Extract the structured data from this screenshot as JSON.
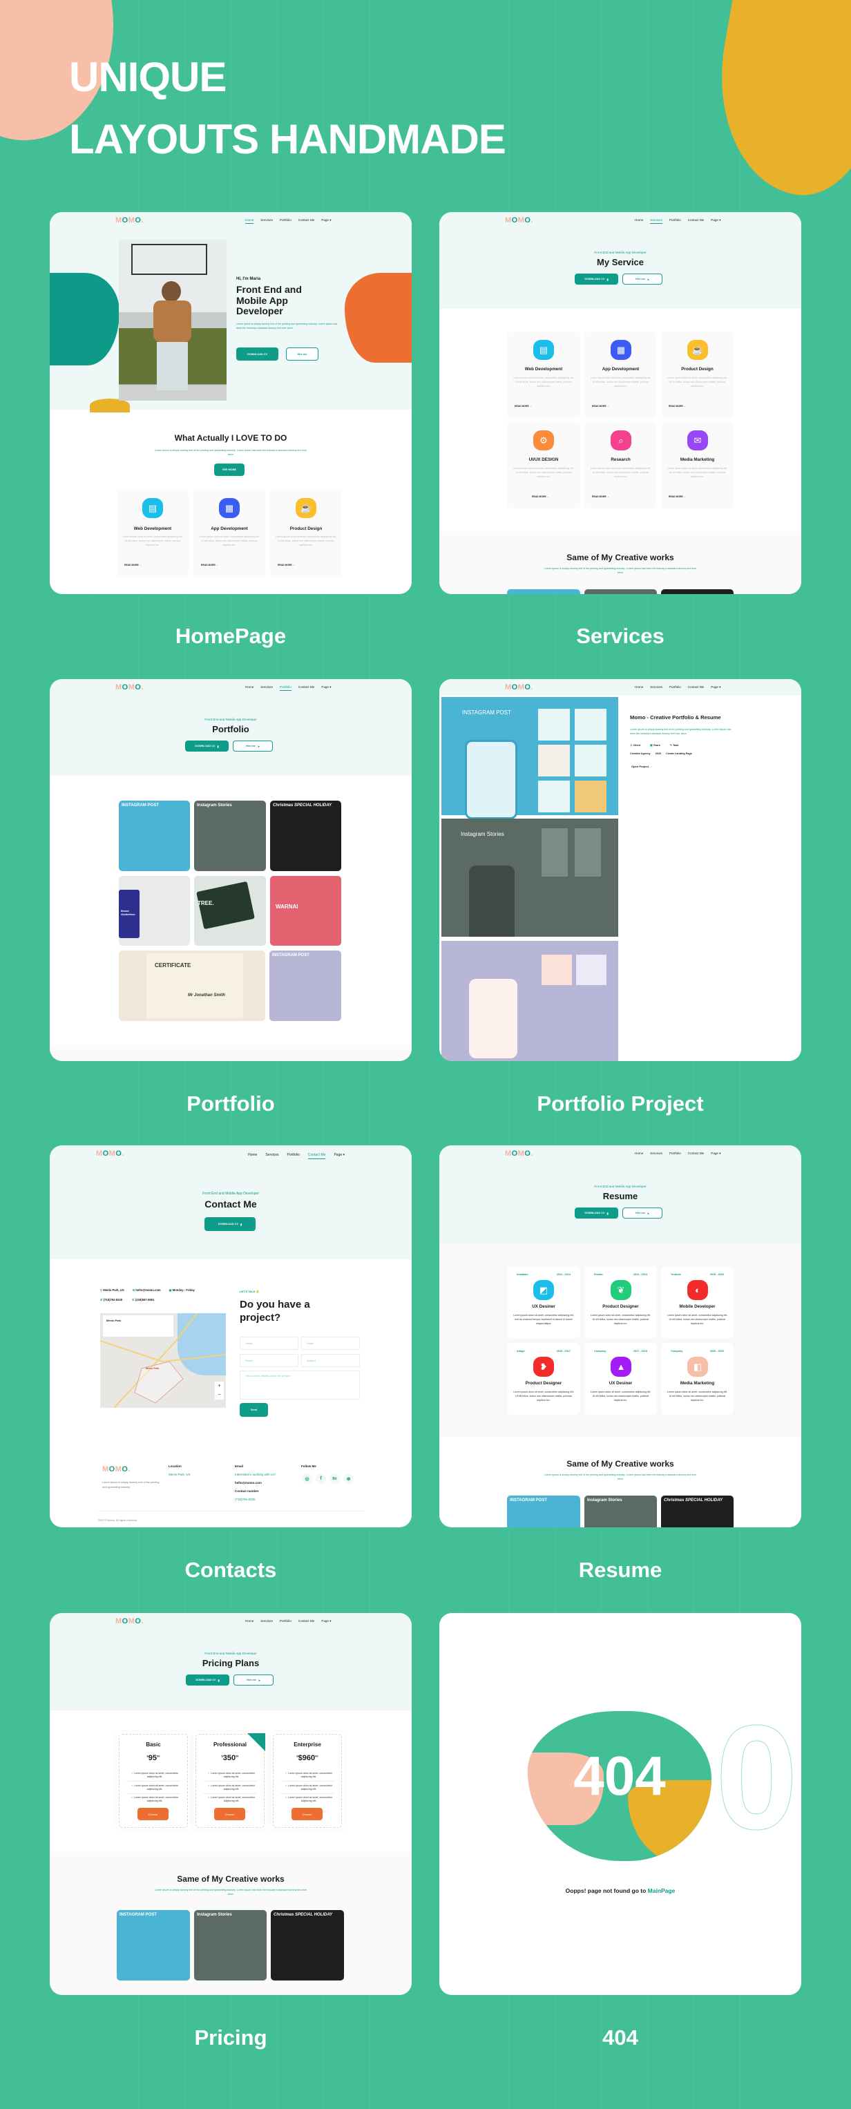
{
  "banner": {
    "line1": "UNIQUE",
    "line2": "LAYOUTS HANDMADE"
  },
  "colors": {
    "background": "#42bf96",
    "brand_teal": "#0f9d8a",
    "peach": "#f8bfa8",
    "yellow": "#e9b02a",
    "orange": "#ec6f31",
    "hero_bg": "#eef8f6"
  },
  "brand": {
    "logo_a": "M",
    "logo_b": "O",
    "logo_c": "M",
    "logo_d": "O",
    "logo_e": "."
  },
  "nav": {
    "home": "Home",
    "services": "Services",
    "portfolio": "Portfolio",
    "contact": "Contact Me",
    "page": "Page"
  },
  "common": {
    "tagline": "Front End and Mobile App Developer",
    "download_cv": "DOWNLOAD CV",
    "hire_me": "Hire me",
    "read_more": "READ MORE",
    "works_title": "Same of My Creative works",
    "works_sub": "Lorem Ipsum is simply dummy text of the printing and typesetting industry. Lorem Ipsum has been the industry's standard dummy text ever since",
    "card_lorem": "Lorem ipsum dolor sit amet, consectetur adipiscing elit. Ut elit tellus, luctus nec ullamcorper mattis, pulvinar dapibus leo."
  },
  "home": {
    "label": "HomePage",
    "greeting": "Hi, I'm Maria",
    "title": "Front End and Mobile App Developer",
    "desc": "Lorem ipsum is simply dummy text of the printing and typesetting industry. Lorem Ipsum has been the industry's standard dummy text ever since",
    "download": "DOWNLOAD CV",
    "hire": "Hire me",
    "section_title": "What Actually I LOVE TO DO",
    "see_more": "SEE MORE",
    "services": [
      "Web Development",
      "App Development",
      "Product Design"
    ]
  },
  "services": {
    "label": "Services",
    "title": "My Service",
    "items": [
      {
        "name": "Web Development",
        "color": "#1bbdea",
        "icon": "browser-icon"
      },
      {
        "name": "App Development",
        "color": "#3a5cf5",
        "icon": "mobile-app-icon"
      },
      {
        "name": "Product Design",
        "color": "#fbbf2c",
        "icon": "product-icon"
      },
      {
        "name": "UI/UX DESIGN",
        "color": "#fb8c3c",
        "icon": "design-icon"
      },
      {
        "name": "Research",
        "color": "#f5408f",
        "icon": "research-icon"
      },
      {
        "name": "Media Marketing",
        "color": "#9747f5",
        "icon": "marketing-icon"
      }
    ]
  },
  "portfolio": {
    "label": "Portfolio",
    "title": "Portfolio",
    "tiles": [
      "INSTAGRAM POST",
      "Instagram Stories",
      "Christmas SPECIAL HOLIDAY",
      "Brand Guidelines",
      "TREE.",
      "WARNAI",
      "CERTIFICATE",
      "Mr Jonathan Smith",
      "INSTAGRAM POST"
    ]
  },
  "project": {
    "label": "Portfolio Project",
    "images": [
      "INSTAGRAM POST",
      "Instagram Stories"
    ],
    "title": "Momo - Creative Portfolio & Resume",
    "desc": "Lorem ipsum is simply dummy text of the printing and typesetting industry. Lorem Ipsum has been the industry's standard dummy text ever since",
    "meta": [
      {
        "label": "Client",
        "value": "Creative Agency"
      },
      {
        "label": "Years",
        "value": "2020"
      },
      {
        "label": "Task",
        "value": "Create Landing Page"
      }
    ],
    "open": "Open Project"
  },
  "contact": {
    "label": "Contacts",
    "title": "Contact Me",
    "info": {
      "location": "Menlo Park, US",
      "email": "hello@momo.com",
      "hours": "Monday - Friday",
      "phone1": "(716)792-8330",
      "phone2": "(219)557-9591"
    },
    "map_place": "Menlo Park",
    "lets_talk": "LET'S TALK",
    "form_title": "Do you have a project?",
    "placeholders": {
      "name": "Name",
      "email": "Email",
      "phone": "Phone",
      "subject": "Subject",
      "message": "Tell us more details about the project"
    },
    "send": "Send",
    "footer": {
      "desc": "Lorem Ipsum is simply dummy text of the printing and typesetting industry.",
      "location_h": "Location",
      "location_v": "Menlo Park, US",
      "email_h": "Email",
      "email_cta": "Interested in working with us?",
      "email_v": "hello@momo.com",
      "contact_h": "Contact number",
      "contact_v": "(716)792-8330",
      "follow_h": "Follow Me",
      "copyright": "2020 © Momo. All rights reserved."
    }
  },
  "resume": {
    "label": "Resume",
    "title": "Resume",
    "items": [
      {
        "company": "Instabam",
        "years": "2012 - 2014",
        "role": "UX Desiner",
        "color": "#1bbdea",
        "desc": "Lorem ipsum dolor sit amet, consectetur adipiscing elit, sed do eiusmod tempor incididunt ut labore et dolore magna aliqua."
      },
      {
        "company": "Envato",
        "years": "2012 - 2014",
        "role": "Product Designer",
        "color": "#21cc7a",
        "desc": "Lorem ipsum dolor sit amet, consectetur adipiscing elit. Ut elit tellus, luctus nec ullamcorper mattis, pulvinar dapibus leo."
      },
      {
        "company": "Youtube",
        "years": "2015 - 2016",
        "role": "Mobile Developer",
        "color": "#f22b2b",
        "desc": "Lorem ipsum dolor sit amet, consectetur adipiscing elit. Ut elit tellus, luctus nec ullamcorper mattis, pulvinar dapibus leo."
      },
      {
        "company": "Adage",
        "years": "2016 - 2017",
        "role": "Product Designer",
        "color": "#f22b2b",
        "desc": "Lorem ipsum dolor sit amet, consectetur adipiscing elit. Ut elit tellus, luctus nec ullamcorper mattis, pulvinar dapibus leo."
      },
      {
        "company": "Company",
        "years": "2017 - 2019",
        "role": "UX Desiner",
        "color": "#a21cf5",
        "desc": "Lorem ipsum dolor sit amet, consectetur adipiscing elit. Ut elit tellus, luctus nec ullamcorper mattis, pulvinar dapibus leo."
      },
      {
        "company": "Company",
        "years": "2020 - 2020",
        "role": "Media Marketing",
        "color": "#f8bfa8",
        "desc": "Lorem ipsum dolor sit amet, consectetur adipiscing elit. Ut elit tellus, luctus nec ullamcorper mattis, pulvinar dapibus leo."
      }
    ]
  },
  "pricing": {
    "label": "Pricing",
    "title": "Pricing Plans",
    "plans": [
      {
        "name": "Basic",
        "currency": "$",
        "price": "95",
        "cents": "00"
      },
      {
        "name": "Professional",
        "currency": "$",
        "price": "350",
        "cents": "00"
      },
      {
        "name": "Enterprise",
        "currency": "$",
        "price": "$960",
        "cents": "00"
      }
    ],
    "feature": "Lorem ipsum dolor sit amet, consectetur adipiscing elit.",
    "choose": "Choose"
  },
  "notfound": {
    "label": "404",
    "code": "404",
    "message": "Oopps! page not found go to",
    "link": "MainPage"
  }
}
